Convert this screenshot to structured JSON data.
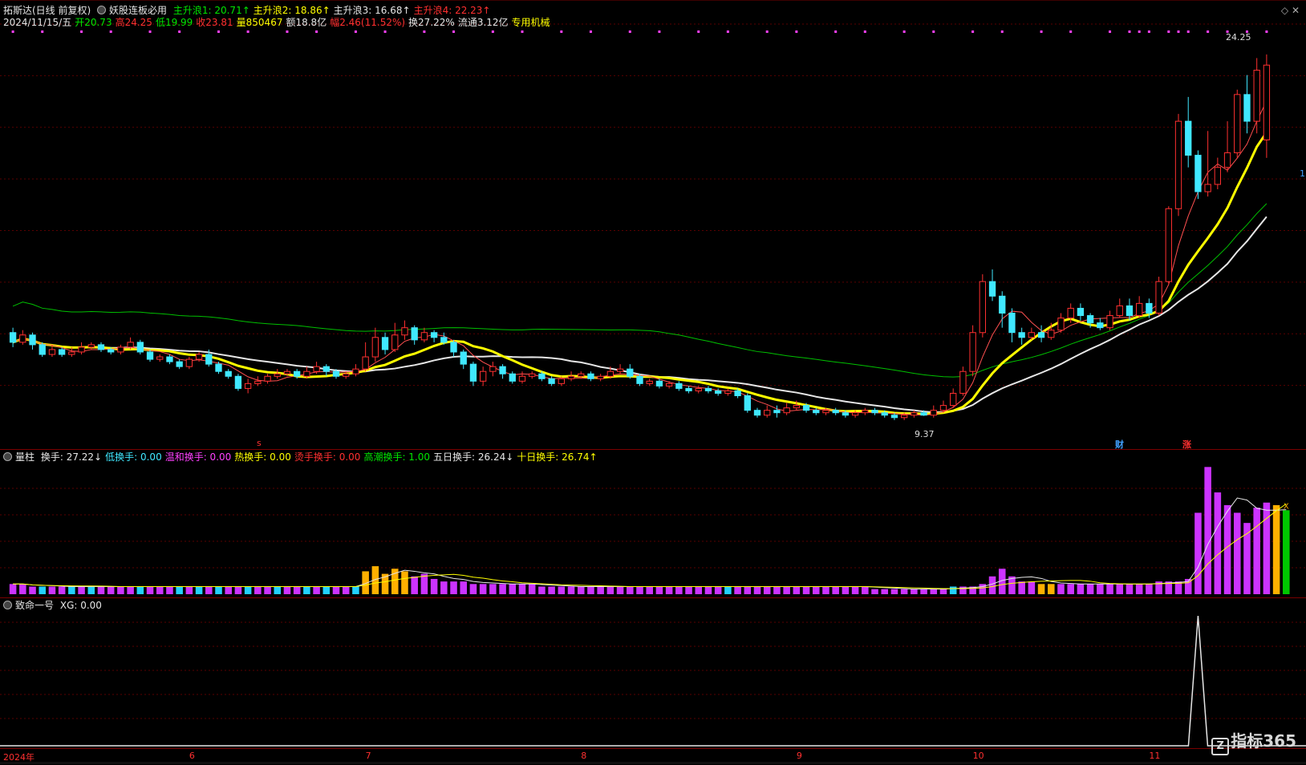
{
  "stock": {
    "name": "拓斯达(日线 前复权)",
    "indicator_name": "妖股连板必用",
    "waves": [
      {
        "label": "主升浪1: 20.71↑",
        "color": "#00e600"
      },
      {
        "label": "主升浪2: 18.86↑",
        "color": "#ffff00"
      },
      {
        "label": "主升浪3: 16.68↑",
        "color": "#e6e6e6"
      },
      {
        "label": "主升浪4: 22.23↑",
        "color": "#ff3030"
      }
    ],
    "quote": {
      "date": "2024/11/15/五",
      "open": "开20.73",
      "high": "高24.25",
      "low": "低19.99",
      "close": "收23.81",
      "volume": "量850467",
      "amount": "额18.8亿",
      "change": "幅2.46(11.52%)",
      "turnover": "换27.22%",
      "float_cap": "流通3.12亿",
      "industry": "专用机械"
    },
    "peak_label": "24.25",
    "low_label": "9.37",
    "marker_cai": "财",
    "marker_zhang": "涨",
    "marker_s": "s",
    "right_edge_label": "1"
  },
  "volume_pane": {
    "title": "量柱",
    "items": [
      {
        "label": "换手: 27.22↓",
        "color": "#e6e6e6"
      },
      {
        "label": "低换手: 0.00",
        "color": "#40e8ff"
      },
      {
        "label": "温和换手: 0.00",
        "color": "#ff40ff"
      },
      {
        "label": "热换手: 0.00",
        "color": "#ffff00"
      },
      {
        "label": "烫手换手: 0.00",
        "color": "#ff3030"
      },
      {
        "label": "高潮换手: 1.00",
        "color": "#00e600"
      },
      {
        "label": "五日换手: 26.24↓",
        "color": "#e6e6e6"
      },
      {
        "label": "十日换手: 26.74↑",
        "color": "#ffff00"
      }
    ]
  },
  "indicator_pane": {
    "title": "致命一号",
    "value": "XG: 0.00"
  },
  "date_axis": [
    {
      "label": "2024年",
      "idx": 0
    },
    {
      "label": "6",
      "idx": 18
    },
    {
      "label": "7",
      "idx": 36
    },
    {
      "label": "8",
      "idx": 58
    },
    {
      "label": "9",
      "idx": 80
    },
    {
      "label": "10",
      "idx": 98
    },
    {
      "label": "11",
      "idx": 116
    }
  ],
  "logo_text": "指标365",
  "colors": {
    "up": "#ff3030",
    "down": "#40e8ff",
    "ma_yellow": "#ffff00",
    "ma_white": "#e6e6e6",
    "ma_green": "#00c000",
    "vol_magenta": "#cc33ff",
    "vol_cyan": "#22d0ff",
    "vol_gold": "#ffb000",
    "vol_green": "#00c800"
  },
  "chart_data": {
    "type": "candlestick",
    "price_range": [
      8.5,
      25.5
    ],
    "candles": [
      [
        12.8,
        12.4,
        13.0,
        12.2
      ],
      [
        12.4,
        12.7,
        12.9,
        12.3
      ],
      [
        12.7,
        12.3,
        12.8,
        12.1
      ],
      [
        12.3,
        11.9,
        12.4,
        11.8
      ],
      [
        11.9,
        12.1,
        12.3,
        11.8
      ],
      [
        12.1,
        11.9,
        12.2,
        11.8
      ],
      [
        11.9,
        12.0,
        12.2,
        11.8
      ],
      [
        12.0,
        12.2,
        12.4,
        11.9
      ],
      [
        12.2,
        12.3,
        12.4,
        12.1
      ],
      [
        12.3,
        12.1,
        12.4,
        12.0
      ],
      [
        12.1,
        12.0,
        12.2,
        11.9
      ],
      [
        12.0,
        12.2,
        12.3,
        11.9
      ],
      [
        12.2,
        12.4,
        12.6,
        12.1
      ],
      [
        12.4,
        12.0,
        12.5,
        11.9
      ],
      [
        12.0,
        11.7,
        12.1,
        11.6
      ],
      [
        11.7,
        11.8,
        11.9,
        11.6
      ],
      [
        11.8,
        11.6,
        11.9,
        11.5
      ],
      [
        11.6,
        11.4,
        11.7,
        11.3
      ],
      [
        11.4,
        11.7,
        11.8,
        11.3
      ],
      [
        11.7,
        11.9,
        12.0,
        11.6
      ],
      [
        11.9,
        11.5,
        12.1,
        11.4
      ],
      [
        11.5,
        11.2,
        11.6,
        11.1
      ],
      [
        11.2,
        11.0,
        11.3,
        10.9
      ],
      [
        11.0,
        10.5,
        11.1,
        10.4
      ],
      [
        10.5,
        10.7,
        10.9,
        10.3
      ],
      [
        10.7,
        10.8,
        11.0,
        10.6
      ],
      [
        10.8,
        11.0,
        11.1,
        10.7
      ],
      [
        11.0,
        11.1,
        11.3,
        10.9
      ],
      [
        11.1,
        11.2,
        11.3,
        11.0
      ],
      [
        11.2,
        11.0,
        11.3,
        10.9
      ],
      [
        11.0,
        11.2,
        11.4,
        10.9
      ],
      [
        11.2,
        11.4,
        11.6,
        11.1
      ],
      [
        11.4,
        11.2,
        11.5,
        11.0
      ],
      [
        11.2,
        11.0,
        11.3,
        10.9
      ],
      [
        11.0,
        11.1,
        11.2,
        10.9
      ],
      [
        11.1,
        11.3,
        11.5,
        11.0
      ],
      [
        11.3,
        11.8,
        12.4,
        11.2
      ],
      [
        11.8,
        12.6,
        13.0,
        11.6
      ],
      [
        12.6,
        12.1,
        12.8,
        11.9
      ],
      [
        12.1,
        12.7,
        13.2,
        12.0
      ],
      [
        12.7,
        13.0,
        13.3,
        12.5
      ],
      [
        13.0,
        12.5,
        13.1,
        12.3
      ],
      [
        12.5,
        12.8,
        13.0,
        12.4
      ],
      [
        12.8,
        12.6,
        12.9,
        12.4
      ],
      [
        12.6,
        12.4,
        12.8,
        12.3
      ],
      [
        12.4,
        12.0,
        12.5,
        11.8
      ],
      [
        12.0,
        11.5,
        12.1,
        11.3
      ],
      [
        11.5,
        10.8,
        11.6,
        10.6
      ],
      [
        10.8,
        11.2,
        11.4,
        10.6
      ],
      [
        11.2,
        11.4,
        11.6,
        11.0
      ],
      [
        11.4,
        11.1,
        11.5,
        10.9
      ],
      [
        11.1,
        10.8,
        11.2,
        10.7
      ],
      [
        10.8,
        11.0,
        11.2,
        10.7
      ],
      [
        11.0,
        11.1,
        11.2,
        10.9
      ],
      [
        11.1,
        10.9,
        11.2,
        10.8
      ],
      [
        10.9,
        10.7,
        11.0,
        10.6
      ],
      [
        10.7,
        10.9,
        11.0,
        10.6
      ],
      [
        10.9,
        11.0,
        11.2,
        10.8
      ],
      [
        11.0,
        11.1,
        11.2,
        10.9
      ],
      [
        11.1,
        10.9,
        11.2,
        10.8
      ],
      [
        10.9,
        11.0,
        11.1,
        10.8
      ],
      [
        11.0,
        11.2,
        11.4,
        10.9
      ],
      [
        11.2,
        11.3,
        11.5,
        11.1
      ],
      [
        11.3,
        11.0,
        11.5,
        10.9
      ],
      [
        11.0,
        10.7,
        11.1,
        10.6
      ],
      [
        10.7,
        10.8,
        10.9,
        10.6
      ],
      [
        10.8,
        10.6,
        10.9,
        10.5
      ],
      [
        10.6,
        10.7,
        10.8,
        10.5
      ],
      [
        10.7,
        10.5,
        10.8,
        10.4
      ],
      [
        10.5,
        10.4,
        10.6,
        10.3
      ],
      [
        10.4,
        10.5,
        10.6,
        10.3
      ],
      [
        10.5,
        10.4,
        10.6,
        10.3
      ],
      [
        10.4,
        10.3,
        10.5,
        10.2
      ],
      [
        10.3,
        10.4,
        10.5,
        10.2
      ],
      [
        10.4,
        10.2,
        10.5,
        10.1
      ],
      [
        10.2,
        9.6,
        10.3,
        9.5
      ],
      [
        9.6,
        9.4,
        9.7,
        9.3
      ],
      [
        9.4,
        9.6,
        9.8,
        9.3
      ],
      [
        9.6,
        9.5,
        9.8,
        9.3
      ],
      [
        9.5,
        9.7,
        9.9,
        9.4
      ],
      [
        9.7,
        9.8,
        10.0,
        9.6
      ],
      [
        9.8,
        9.6,
        9.9,
        9.5
      ],
      [
        9.6,
        9.5,
        9.7,
        9.4
      ],
      [
        9.5,
        9.6,
        9.7,
        9.4
      ],
      [
        9.6,
        9.5,
        9.7,
        9.4
      ],
      [
        9.5,
        9.4,
        9.6,
        9.3
      ],
      [
        9.4,
        9.5,
        9.6,
        9.3
      ],
      [
        9.5,
        9.6,
        9.7,
        9.4
      ],
      [
        9.6,
        9.5,
        9.7,
        9.4
      ],
      [
        9.5,
        9.4,
        9.6,
        9.3
      ],
      [
        9.4,
        9.3,
        9.5,
        9.2
      ],
      [
        9.3,
        9.4,
        9.5,
        9.2
      ],
      [
        9.4,
        9.5,
        9.6,
        9.3
      ],
      [
        9.5,
        9.4,
        9.6,
        9.37
      ],
      [
        9.4,
        9.6,
        9.8,
        9.3
      ],
      [
        9.6,
        9.8,
        10.0,
        9.5
      ],
      [
        9.8,
        10.3,
        10.5,
        9.7
      ],
      [
        10.3,
        11.2,
        11.4,
        10.2
      ],
      [
        11.2,
        12.8,
        13.1,
        11.0
      ],
      [
        12.8,
        14.9,
        15.2,
        12.6
      ],
      [
        14.9,
        14.3,
        15.4,
        14.1
      ],
      [
        14.3,
        13.6,
        14.5,
        13.0
      ],
      [
        13.6,
        12.8,
        13.8,
        12.4
      ],
      [
        12.8,
        12.6,
        13.0,
        12.3
      ],
      [
        12.6,
        12.8,
        13.0,
        12.5
      ],
      [
        12.8,
        12.6,
        13.1,
        12.4
      ],
      [
        12.6,
        12.9,
        13.2,
        12.5
      ],
      [
        12.9,
        13.4,
        13.6,
        12.8
      ],
      [
        13.4,
        13.8,
        14.0,
        13.2
      ],
      [
        13.8,
        13.5,
        14.0,
        13.3
      ],
      [
        13.5,
        13.2,
        13.6,
        13.0
      ],
      [
        13.2,
        13.0,
        13.4,
        12.9
      ],
      [
        13.0,
        13.5,
        13.7,
        12.9
      ],
      [
        13.5,
        13.9,
        14.2,
        13.4
      ],
      [
        13.9,
        13.5,
        14.2,
        13.3
      ],
      [
        13.5,
        14.0,
        14.3,
        13.4
      ],
      [
        14.0,
        13.6,
        14.2,
        13.4
      ],
      [
        13.6,
        14.9,
        15.1,
        13.5
      ],
      [
        14.9,
        17.9,
        18.0,
        14.8
      ],
      [
        17.9,
        21.5,
        21.8,
        17.6
      ],
      [
        21.5,
        20.1,
        22.5,
        19.6
      ],
      [
        20.1,
        18.6,
        20.3,
        18.3
      ],
      [
        18.6,
        18.9,
        21.1,
        18.4
      ],
      [
        18.9,
        19.6,
        20.0,
        18.7
      ],
      [
        19.6,
        20.2,
        21.5,
        19.4
      ],
      [
        20.2,
        22.6,
        22.8,
        20.0
      ],
      [
        22.6,
        21.5,
        23.4,
        21.0
      ],
      [
        21.5,
        23.6,
        24.1,
        21.0
      ],
      [
        20.73,
        23.81,
        24.25,
        19.99
      ]
    ],
    "volumes": [
      4,
      4,
      3,
      3,
      3,
      3,
      3,
      3,
      3,
      3,
      3,
      3,
      3,
      3,
      3,
      3,
      3,
      3,
      3,
      3,
      3,
      3,
      3,
      3,
      3,
      3,
      3,
      3,
      3,
      3,
      3,
      3,
      3,
      3,
      3,
      3,
      9,
      11,
      8,
      10,
      9,
      7,
      8,
      6,
      5,
      5,
      5,
      4,
      4,
      4,
      4,
      4,
      4,
      4,
      3,
      3,
      3,
      3,
      3,
      3,
      3,
      3,
      3,
      3,
      3,
      3,
      3,
      3,
      3,
      3,
      3,
      3,
      3,
      3,
      3,
      3,
      3,
      3,
      3,
      3,
      3,
      3,
      3,
      3,
      3,
      3,
      3,
      3,
      2,
      2,
      2,
      2,
      2,
      2,
      2,
      2,
      3,
      3,
      3,
      4,
      7,
      10,
      7,
      5,
      5,
      4,
      4,
      4,
      4,
      4,
      4,
      4,
      4,
      4,
      4,
      4,
      4,
      5,
      5,
      5,
      6,
      32,
      50,
      40,
      35,
      32,
      28,
      34,
      36,
      35,
      33
    ],
    "vol_colors": "mmmcmmcmcmmmmcmmmcmcmcmmcmmcmmcmcmmcgggggmmmmmmmmmmmmmmmmmmmmmmmmmmmmmmmmcmmmmmmmmmmmmmmmmmmmmmmcmmmmmmmmggmmmmmmmmmmmmmmmmmmmmmmgGGGGGGGGGG",
    "signal_index": 121
  }
}
